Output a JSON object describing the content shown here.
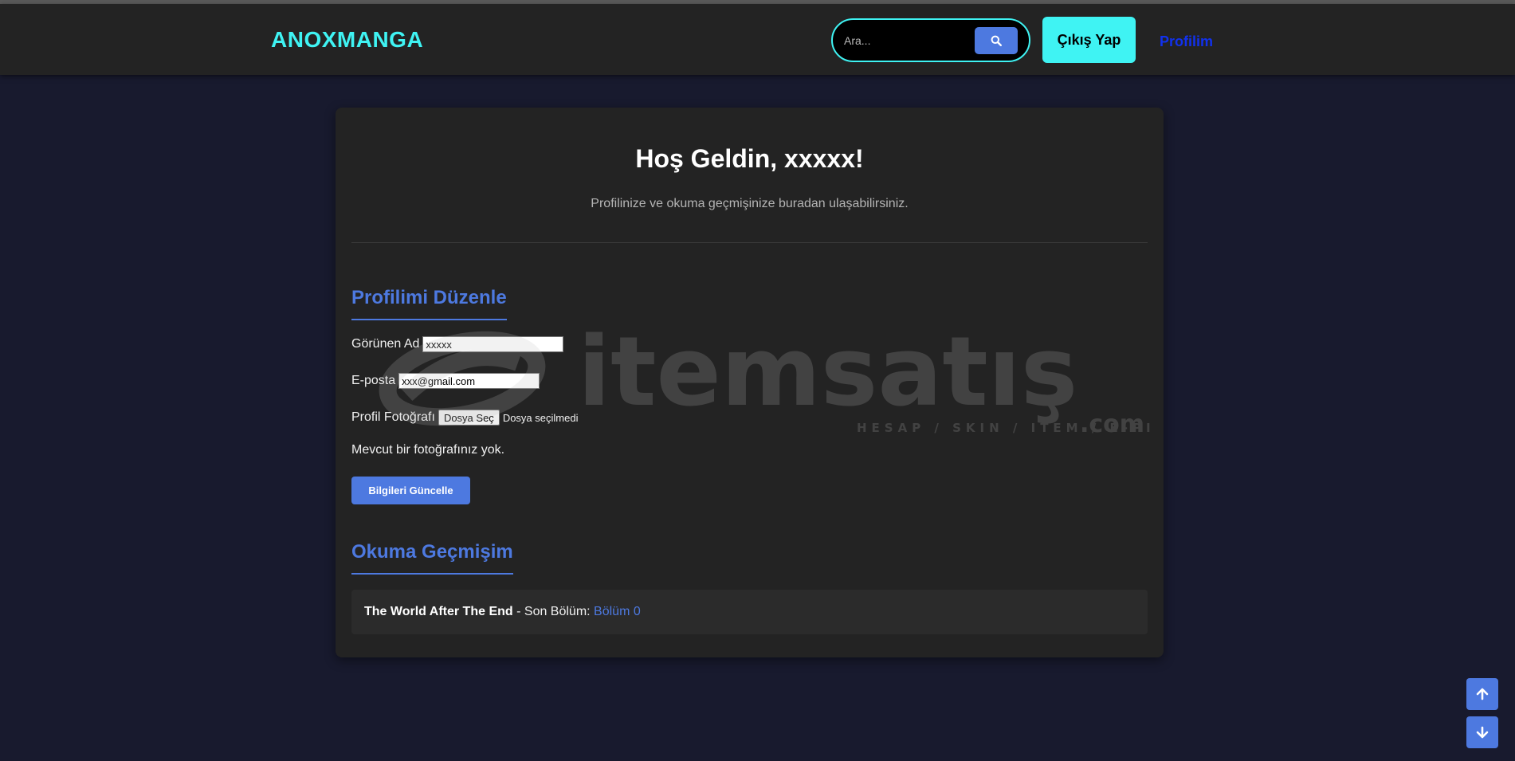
{
  "header": {
    "brand": "ANOXMANGA",
    "search_placeholder": "Ara...",
    "logout_label": "Çıkış Yap",
    "profile_label": "Profilim"
  },
  "welcome": {
    "title": "Hoş Geldin, xxxxx!",
    "subtitle": "Profilinize ve okuma geçmişinize buradan ulaşabilirsiniz."
  },
  "edit_profile": {
    "title": "Profilimi Düzenle",
    "display_name_label": "Görünen Ad",
    "display_name_value": "xxxxx",
    "email_label": "E-posta",
    "email_value": "xxx@gmail.com",
    "photo_label": "Profil Fotoğrafı",
    "choose_file_label": "Dosya Seç",
    "no_file_text": "Dosya seçilmedi",
    "no_photo_text": "Mevcut bir fotoğrafınız yok.",
    "update_button": "Bilgileri Güncelle"
  },
  "history": {
    "title": "Okuma Geçmişim",
    "items": [
      {
        "manga": "The World After The End",
        "separator": " - Son Bölüm: ",
        "chapter": "Bölüm 0"
      }
    ]
  },
  "watermark": {
    "brand": "itemsatış",
    "tagline": "HESAP / SKIN / ITEM / E-PIN",
    "suffix": ".com"
  },
  "icons": {
    "search": "search-icon",
    "scroll_up": "arrow-up-icon",
    "scroll_down": "arrow-down-icon"
  },
  "colors": {
    "accent_cyan": "#3ff3f3",
    "accent_blue": "#4d79e0",
    "link_blue": "#1131ee",
    "page_bg": "#181a2e",
    "panel_bg": "#232323"
  }
}
